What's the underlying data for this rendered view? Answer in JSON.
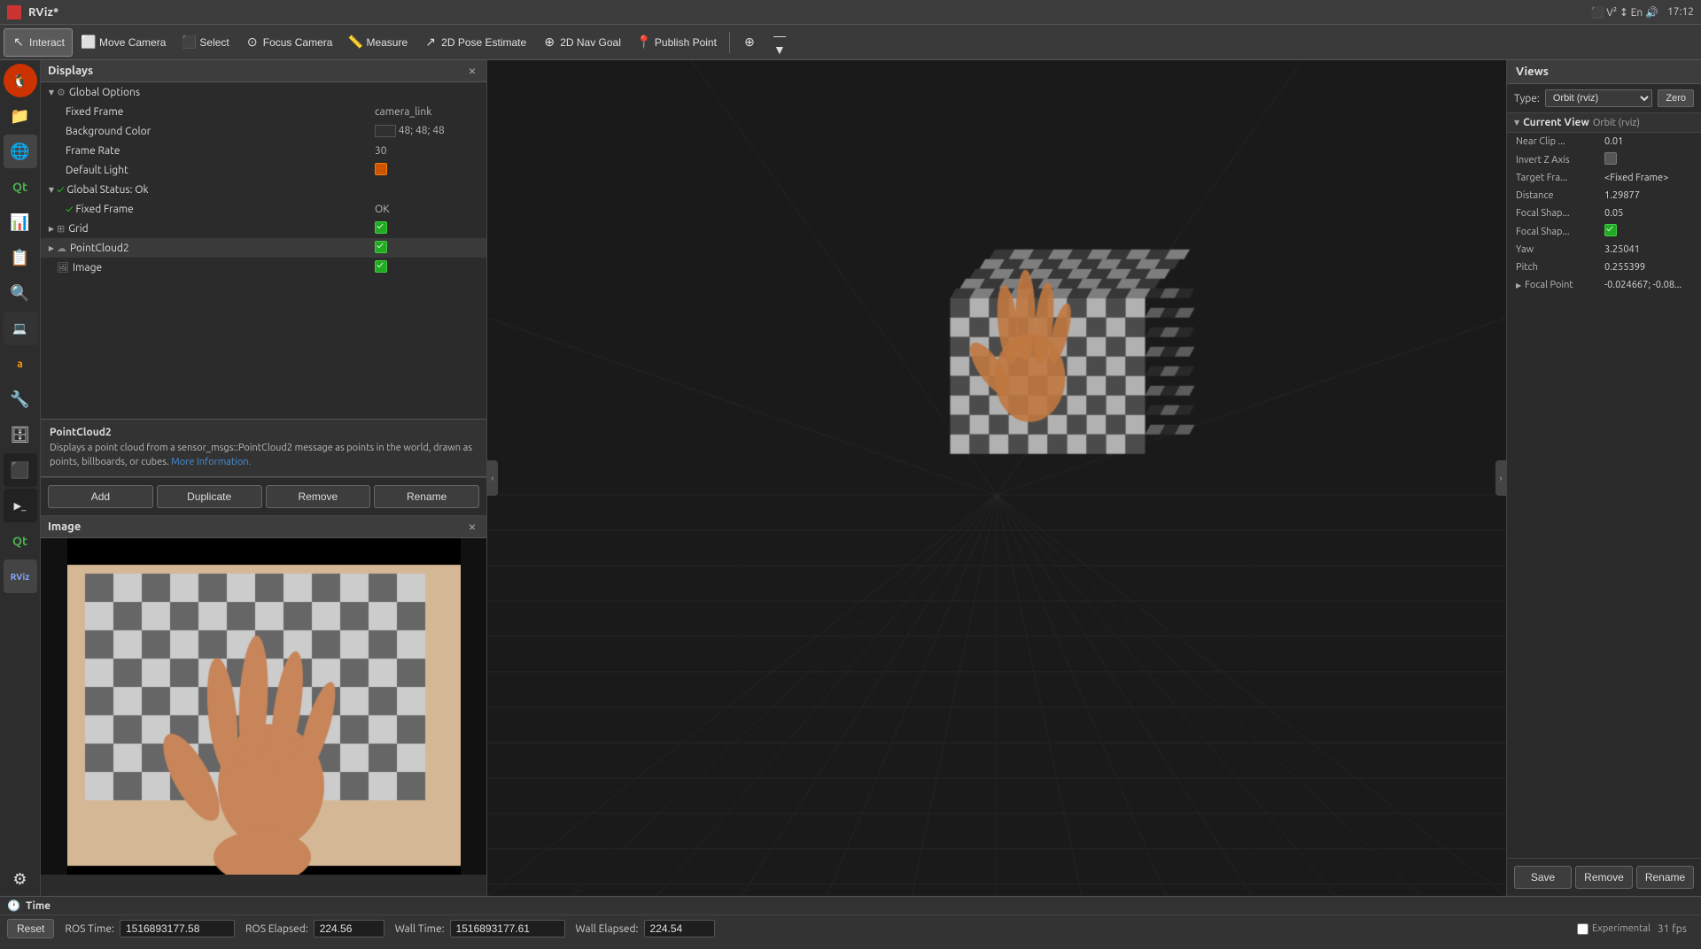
{
  "titlebar": {
    "title": "RViz*",
    "time": "17:12",
    "close_label": "×"
  },
  "toolbar": {
    "interact_label": "Interact",
    "move_camera_label": "Move Camera",
    "select_label": "Select",
    "focus_camera_label": "Focus Camera",
    "measure_label": "Measure",
    "pose_estimate_label": "2D Pose Estimate",
    "nav_goal_label": "2D Nav Goal",
    "publish_point_label": "Publish Point"
  },
  "displays": {
    "panel_title": "Displays",
    "close_label": "×",
    "global_options_label": "Global Options",
    "fixed_frame_label": "Fixed Frame",
    "fixed_frame_value": "camera_link",
    "bg_color_label": "Background Color",
    "bg_color_value": "48; 48; 48",
    "frame_rate_label": "Frame Rate",
    "frame_rate_value": "30",
    "default_light_label": "Default Light",
    "global_status_label": "Global Status: Ok",
    "status_fixed_frame_label": "Fixed Frame",
    "status_fixed_frame_value": "OK",
    "grid_label": "Grid",
    "pointcloud2_label": "PointCloud2",
    "image_label": "Image",
    "description_plugin": "PointCloud2",
    "description_text": "Displays a point cloud from a sensor_msgs::PointCloud2 message as points in the world, drawn as points, billboards, or cubes.",
    "description_link": "More Information.",
    "btn_add": "Add",
    "btn_duplicate": "Duplicate",
    "btn_remove": "Remove",
    "btn_rename": "Rename"
  },
  "image_panel": {
    "panel_title": "Image",
    "close_label": "×"
  },
  "views": {
    "panel_title": "Views",
    "type_label": "Type:",
    "type_value": "Orbit (rviz)",
    "zero_label": "Zero",
    "current_view_label": "Current View",
    "current_view_type": "Orbit (rviz)",
    "near_clip_label": "Near Clip ...",
    "near_clip_value": "0.01",
    "invert_z_label": "Invert Z Axis",
    "target_frame_label": "Target Fra...",
    "target_frame_value": "<Fixed Frame>",
    "distance_label": "Distance",
    "distance_value": "1.29877",
    "focal_shape_label1": "Focal Shap...",
    "focal_shape_value1": "0.05",
    "focal_shape_label2": "Focal Shap...",
    "yaw_label": "Yaw",
    "yaw_value": "3.25041",
    "pitch_label": "Pitch",
    "pitch_value": "0.255399",
    "focal_point_label": "Focal Point",
    "focal_point_value": "-0.024667; -0.08...",
    "btn_save": "Save",
    "btn_remove": "Remove",
    "btn_rename": "Rename"
  },
  "bottom": {
    "time_label": "Time",
    "ros_time_label": "ROS Time:",
    "ros_time_value": "1516893177.58",
    "ros_elapsed_label": "ROS Elapsed:",
    "ros_elapsed_value": "224.56",
    "wall_time_label": "Wall Time:",
    "wall_time_value": "1516893177.61",
    "wall_elapsed_label": "Wall Elapsed:",
    "wall_elapsed_value": "224.54",
    "reset_label": "Reset",
    "experimental_label": "Experimental",
    "fps_label": "31 fps"
  },
  "sidebar": {
    "icons": [
      "🐧",
      "📁",
      "🔧",
      "⚙",
      "📊",
      "📋",
      "🔍",
      "🖥",
      "📦",
      "🛒",
      "🔨",
      "🗄",
      "⬛",
      "▶",
      "🔧",
      "🔲"
    ]
  }
}
